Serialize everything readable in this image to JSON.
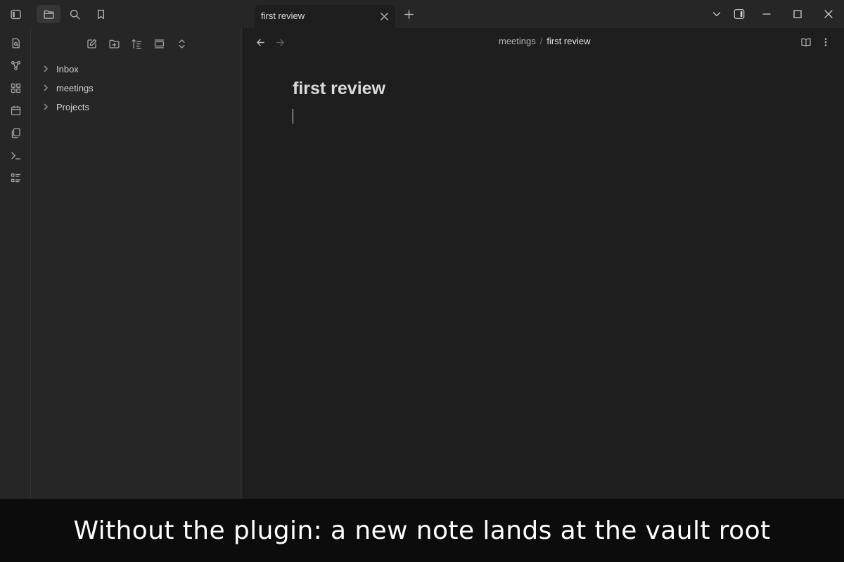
{
  "titlebar": {
    "icons": [
      "sidebar-toggle-icon",
      "folder-icon",
      "search-icon",
      "bookmark-icon"
    ],
    "tab": {
      "title": "first review",
      "close_icon": "close-icon"
    },
    "new_tab_icon": "plus-icon",
    "window_controls": [
      "chevron-down-icon",
      "right-sidebar-icon",
      "minimize-icon",
      "maximize-icon",
      "close-icon"
    ]
  },
  "ribbon": {
    "icons": [
      "quick-switcher-icon",
      "graph-view-icon",
      "canvas-icon",
      "daily-note-icon",
      "templates-icon",
      "command-palette-icon",
      "outline-icon"
    ]
  },
  "sidebar": {
    "toolbar": [
      "new-note-icon",
      "new-folder-icon",
      "sort-icon",
      "auto-reveal-icon",
      "collapse-all-icon"
    ],
    "tree": [
      {
        "label": "Inbox"
      },
      {
        "label": "meetings"
      },
      {
        "label": "Projects"
      }
    ]
  },
  "editor": {
    "breadcrumb": {
      "folder": "meetings",
      "separator": "/",
      "file": "first review"
    },
    "title": "first review"
  },
  "caption": "Without the plugin: a new note lands at the vault root",
  "colors": {
    "background": "#1e1e1e",
    "sidebar": "#262626",
    "caption_bg": "#0c0c0c",
    "text": "#dadada"
  }
}
